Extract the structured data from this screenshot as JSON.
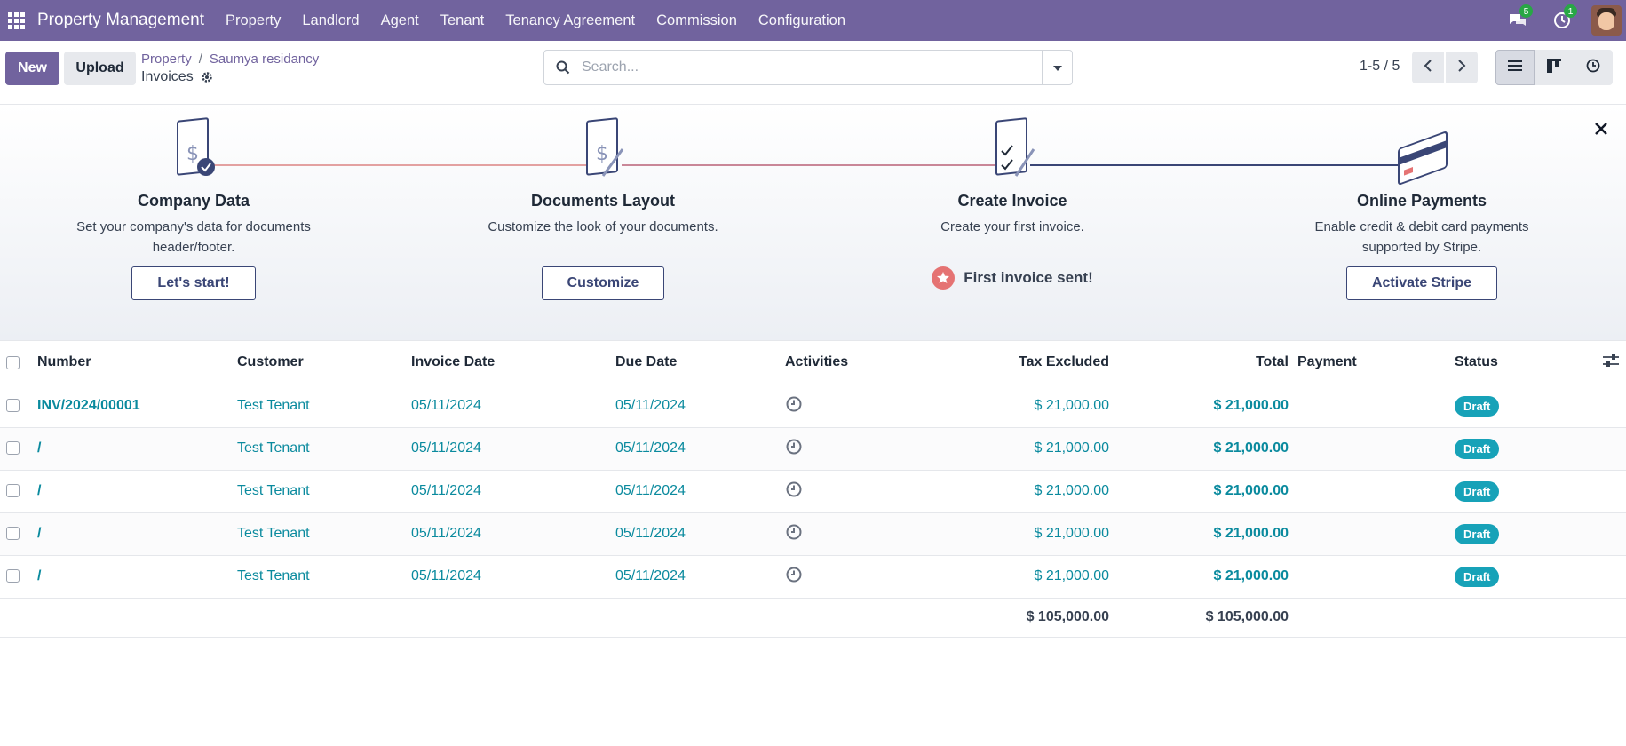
{
  "navbar": {
    "brand": "Property Management",
    "menu": [
      "Property",
      "Landlord",
      "Agent",
      "Tenant",
      "Tenancy Agreement",
      "Commission",
      "Configuration"
    ],
    "messages_count": "5",
    "activities_count": "1",
    "bg_color": "#71639e"
  },
  "control": {
    "new_label": "New",
    "upload_label": "Upload",
    "breadcrumb": [
      "Property",
      "Saumya residancy"
    ],
    "breadcrumb_sep": "/",
    "title": "Invoices",
    "search_placeholder": "Search...",
    "pager": "1-5 / 5"
  },
  "banner": {
    "steps": [
      {
        "title": "Company Data",
        "desc": "Set your company's data for documents header/footer.",
        "button": "Let's start!"
      },
      {
        "title": "Documents Layout",
        "desc": "Customize the look of your documents.",
        "button": "Customize"
      },
      {
        "title": "Create Invoice",
        "desc": "Create your first invoice.",
        "done": "First invoice sent!"
      },
      {
        "title": "Online Payments",
        "desc": "Enable credit & debit card payments supported by Stripe.",
        "button": "Activate Stripe"
      }
    ]
  },
  "table": {
    "headers": {
      "number": "Number",
      "customer": "Customer",
      "invoice_date": "Invoice Date",
      "due_date": "Due Date",
      "activities": "Activities",
      "tax_excluded": "Tax Excluded",
      "total": "Total",
      "payment": "Payment",
      "status": "Status"
    },
    "rows": [
      {
        "number": "INV/2024/00001",
        "customer": "Test Tenant",
        "invoice_date": "05/11/2024",
        "due_date": "05/11/2024",
        "tax_excluded": "$ 21,000.00",
        "total": "$ 21,000.00",
        "status": "Draft"
      },
      {
        "number": "/",
        "customer": "Test Tenant",
        "invoice_date": "05/11/2024",
        "due_date": "05/11/2024",
        "tax_excluded": "$ 21,000.00",
        "total": "$ 21,000.00",
        "status": "Draft"
      },
      {
        "number": "/",
        "customer": "Test Tenant",
        "invoice_date": "05/11/2024",
        "due_date": "05/11/2024",
        "tax_excluded": "$ 21,000.00",
        "total": "$ 21,000.00",
        "status": "Draft"
      },
      {
        "number": "/",
        "customer": "Test Tenant",
        "invoice_date": "05/11/2024",
        "due_date": "05/11/2024",
        "tax_excluded": "$ 21,000.00",
        "total": "$ 21,000.00",
        "status": "Draft"
      },
      {
        "number": "/",
        "customer": "Test Tenant",
        "invoice_date": "05/11/2024",
        "due_date": "05/11/2024",
        "tax_excluded": "$ 21,000.00",
        "total": "$ 21,000.00",
        "status": "Draft"
      }
    ],
    "totals": {
      "tax_excluded": "$ 105,000.00",
      "total": "$ 105,000.00"
    }
  }
}
